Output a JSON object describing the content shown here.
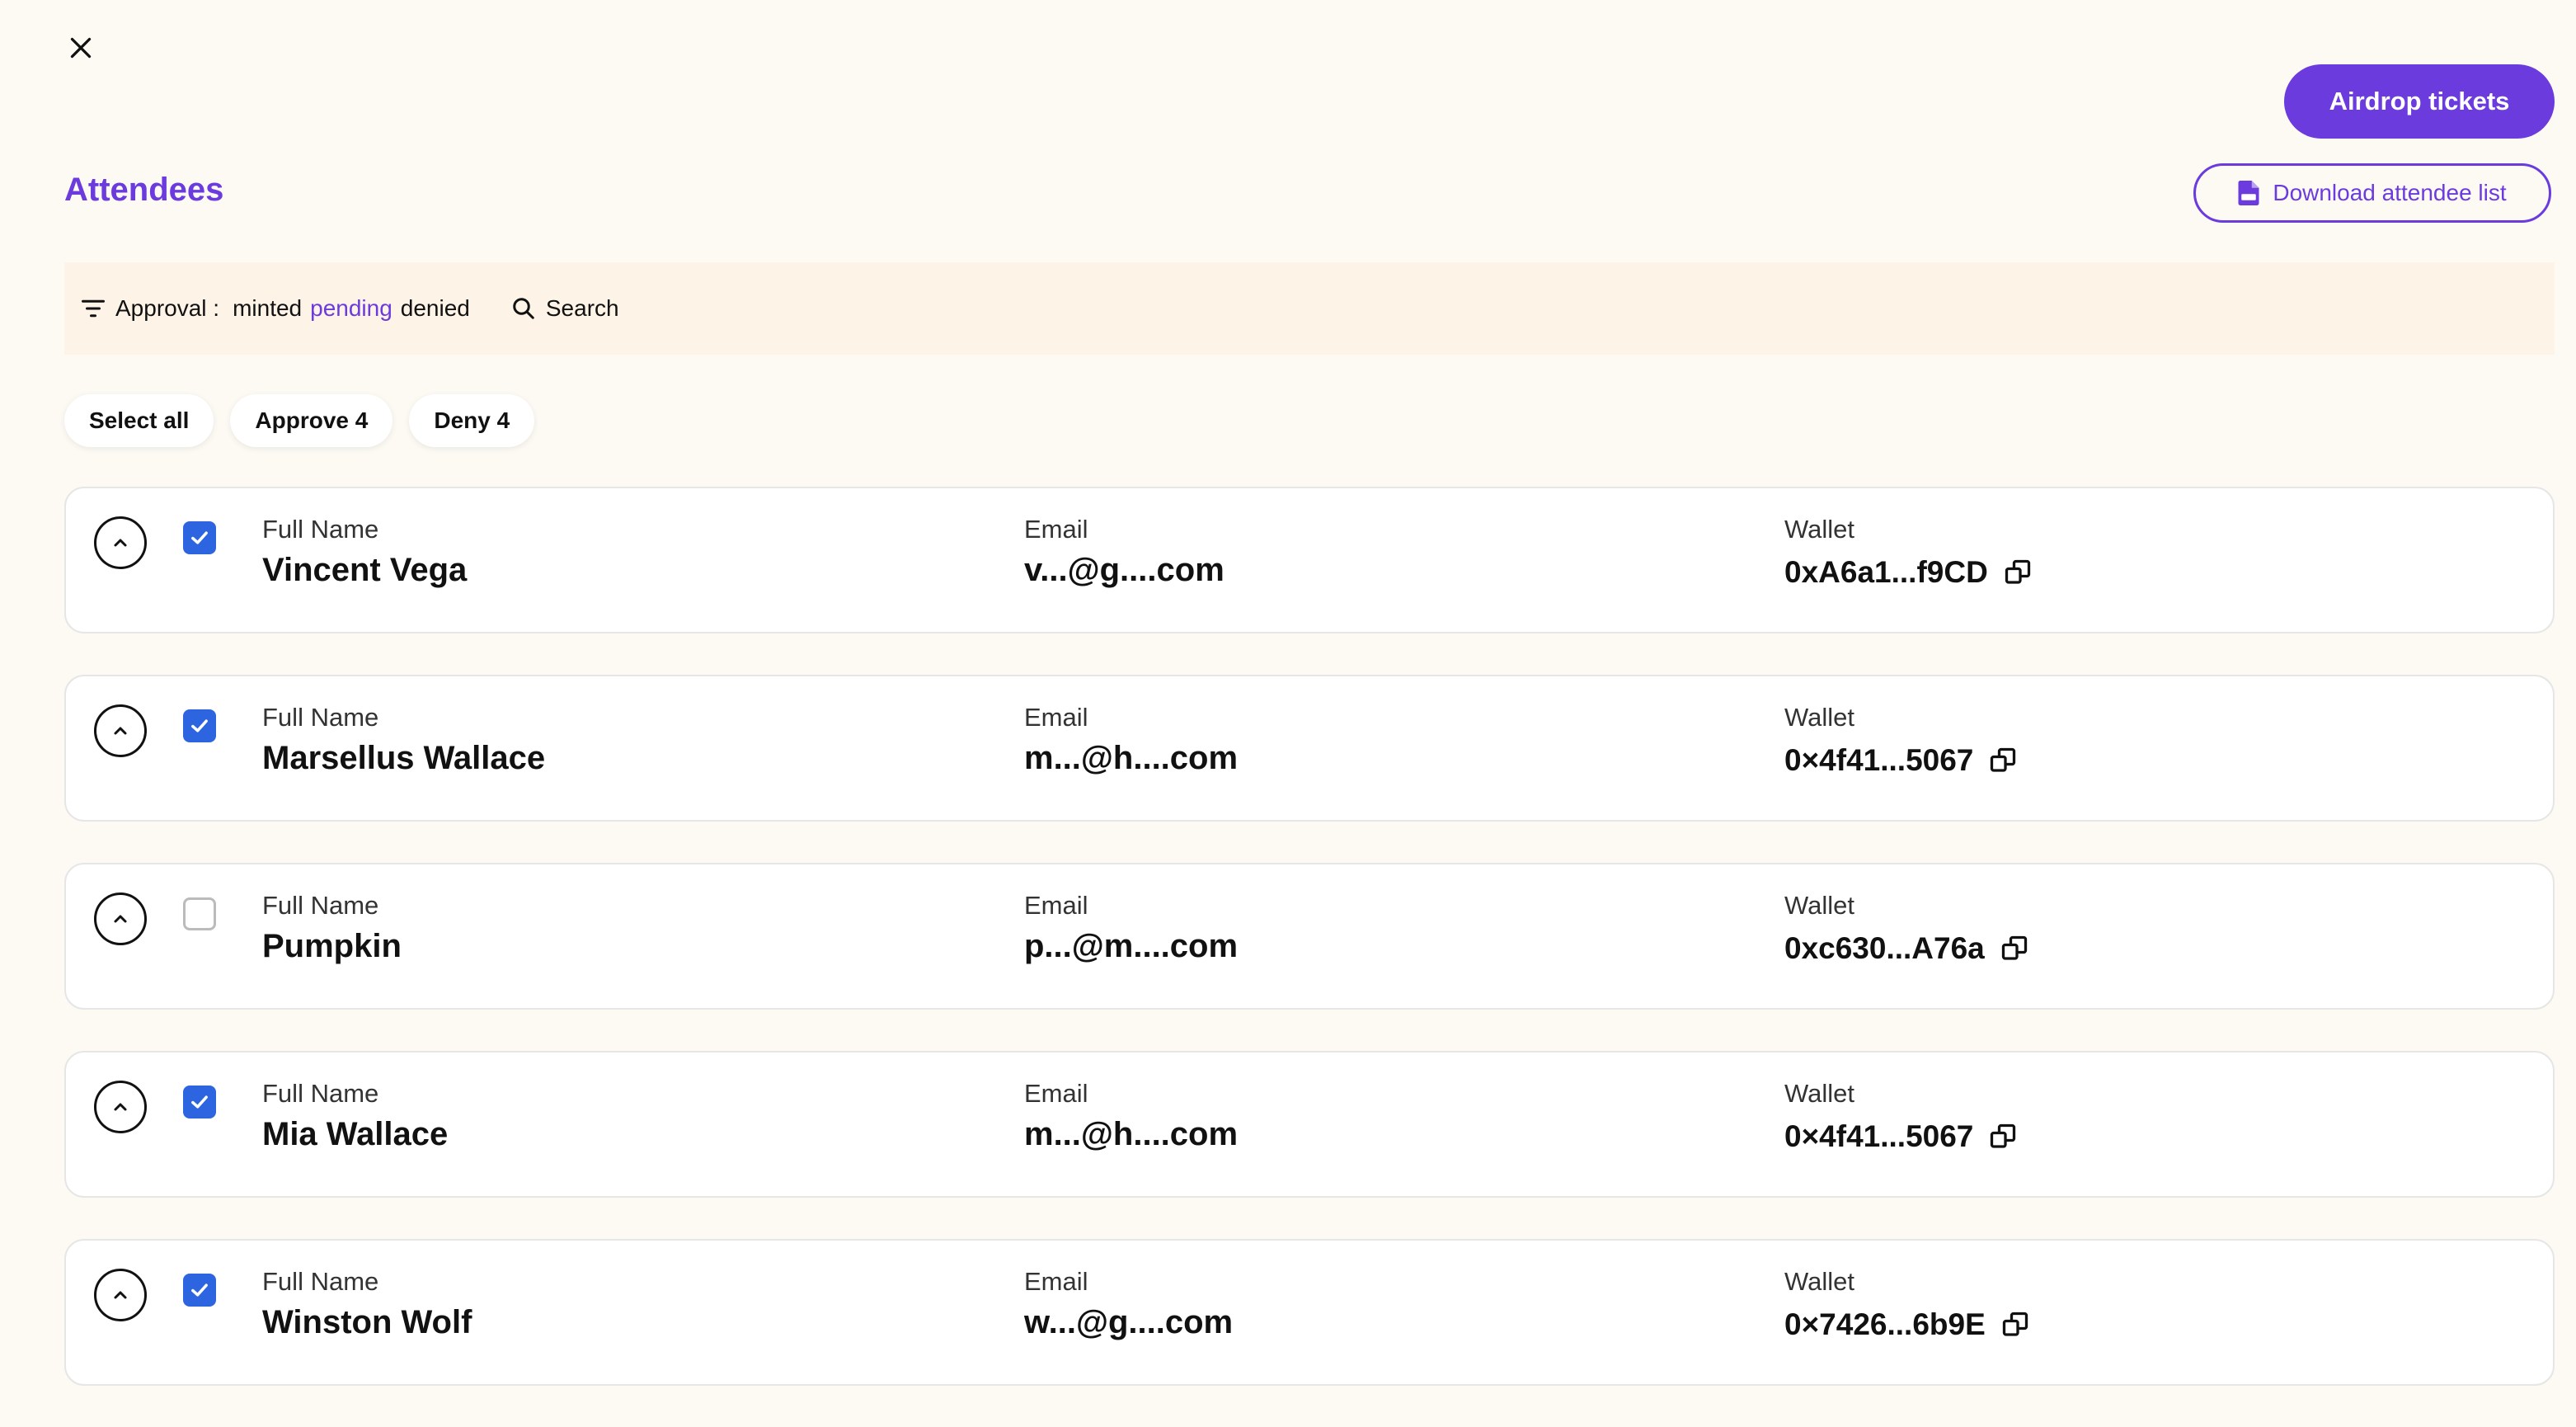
{
  "header": {
    "title": "Attendees",
    "airdrop_label": "Airdrop tickets",
    "download_label": "Download attendee list"
  },
  "filter": {
    "label": "Approval :",
    "options": [
      {
        "label": "minted",
        "active": false
      },
      {
        "label": "pending",
        "active": true
      },
      {
        "label": "denied",
        "active": false
      }
    ],
    "search_label": "Search"
  },
  "actions": {
    "select_all": "Select all",
    "approve": "Approve 4",
    "deny": "Deny 4"
  },
  "columns": {
    "name": "Full Name",
    "email": "Email",
    "wallet": "Wallet"
  },
  "attendees": [
    {
      "name": "Vincent Vega",
      "email": "v...@g....com",
      "wallet": "0xA6a1...f9CD",
      "checked": true
    },
    {
      "name": "Marsellus Wallace",
      "email": "m...@h....com",
      "wallet": "0×4f41...5067",
      "checked": true
    },
    {
      "name": "Pumpkin",
      "email": "p...@m....com",
      "wallet": "0xc630...A76a",
      "checked": false
    },
    {
      "name": "Mia Wallace",
      "email": "m...@h....com",
      "wallet": "0×4f41...5067",
      "checked": true
    },
    {
      "name": "Winston Wolf",
      "email": "w...@g....com",
      "wallet": "0×7426...6b9E",
      "checked": true
    }
  ],
  "colors": {
    "accent": "#6b3bdd",
    "checkbox": "#2d64e0",
    "filter_bg": "#fdf3e6",
    "page_bg": "#fdfaf4"
  }
}
